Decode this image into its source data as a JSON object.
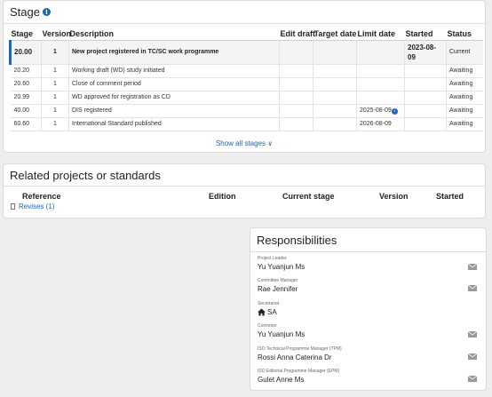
{
  "stage": {
    "title": "Stage",
    "columns": [
      "Stage",
      "Version",
      "Description",
      "Edit draft",
      "Target date",
      "Limit date",
      "Started",
      "Status"
    ],
    "rows": [
      {
        "stage": "20.00",
        "version": "1",
        "description": "New project registered in TC/SC work programme",
        "edit_draft": "",
        "target_date": "",
        "limit_date": "",
        "started": "2023-08-09",
        "status": "Current"
      },
      {
        "stage": "20.20",
        "version": "1",
        "description": "Working draft (WD) study initiated",
        "edit_draft": "",
        "target_date": "",
        "limit_date": "",
        "started": "",
        "status": "Awaiting"
      },
      {
        "stage": "20.60",
        "version": "1",
        "description": "Close of comment period",
        "edit_draft": "",
        "target_date": "",
        "limit_date": "",
        "started": "",
        "status": "Awaiting"
      },
      {
        "stage": "20.99",
        "version": "1",
        "description": "WD approved for registration as CD",
        "edit_draft": "",
        "target_date": "",
        "limit_date": "",
        "started": "",
        "status": "Awaiting"
      },
      {
        "stage": "40.00",
        "version": "1",
        "description": "DIS registered",
        "edit_draft": "",
        "target_date": "",
        "limit_date": "2025-08-09",
        "started": "",
        "status": "Awaiting"
      },
      {
        "stage": "60.60",
        "version": "1",
        "description": "International Standard published",
        "edit_draft": "",
        "target_date": "",
        "limit_date": "2026-08-09",
        "started": "",
        "status": "Awaiting"
      }
    ],
    "show_all": "Show all stages ∨"
  },
  "related": {
    "title": "Related projects or standards",
    "columns": [
      "Reference",
      "Edition",
      "Current stage",
      "Version",
      "Started"
    ],
    "link": "Revises (1)"
  },
  "responsibilities": {
    "title": "Responsibilities",
    "items": [
      {
        "role": "Project Leader",
        "name": "Yu Yuanjun Ms",
        "has_mail": true
      },
      {
        "role": "Committee Manager",
        "name": "Rae Jennifer",
        "has_mail": true
      },
      {
        "role": "Secretariat",
        "name": "SA",
        "has_mail": false
      },
      {
        "role": "Convenor",
        "name": "Yu Yuanjun Ms",
        "has_mail": true
      },
      {
        "role": "ISO Technical Programme Manager (TPM)",
        "name": "Rossi Anna Caterina Dr",
        "has_mail": true
      },
      {
        "role": "ISO Editorial Programme Manager (EPM)",
        "name": "Gulet Anne Ms",
        "has_mail": true
      }
    ]
  },
  "colors": {
    "accent": "#1a66b8",
    "background": "#eeeeee",
    "card_border": "#d9d9d9"
  },
  "icons": [
    "info-icon",
    "chevron-down-icon",
    "document-icon",
    "home-icon",
    "mail-icon"
  ]
}
